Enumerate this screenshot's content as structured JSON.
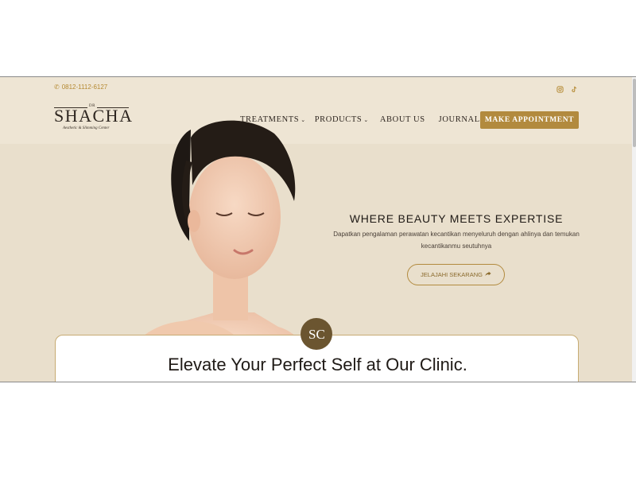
{
  "topbar": {
    "phone": "0812-1112-6127",
    "social": [
      "instagram-icon",
      "tiktok-icon"
    ]
  },
  "logo": {
    "dr": "DR",
    "name": "SHACHA",
    "tagline": "Aesthetic & Slimming Center"
  },
  "nav": {
    "items": [
      {
        "label": "TREATMENTS",
        "dropdown": true
      },
      {
        "label": "PRODUCTS",
        "dropdown": true
      },
      {
        "label": "ABOUT US",
        "dropdown": false
      },
      {
        "label": "JOURNAL",
        "dropdown": false
      }
    ],
    "cta": "MAKE APPOINTMENT"
  },
  "hero": {
    "title": "WHERE BEAUTY MEETS EXPERTISE",
    "description": "Dapatkan pengalaman perawatan kecantikan menyeluruh dengan ahlinya dan temukan kecantikanmu seutuhnya",
    "button": "JELAJAHI SEKARANG"
  },
  "badge": {
    "monogram": "SC"
  },
  "section": {
    "title": "Elevate Your Perfect Self at Our Clinic."
  },
  "colors": {
    "accent": "#b28a3e",
    "background": "#e9dfcc",
    "badge": "#6b5530"
  }
}
